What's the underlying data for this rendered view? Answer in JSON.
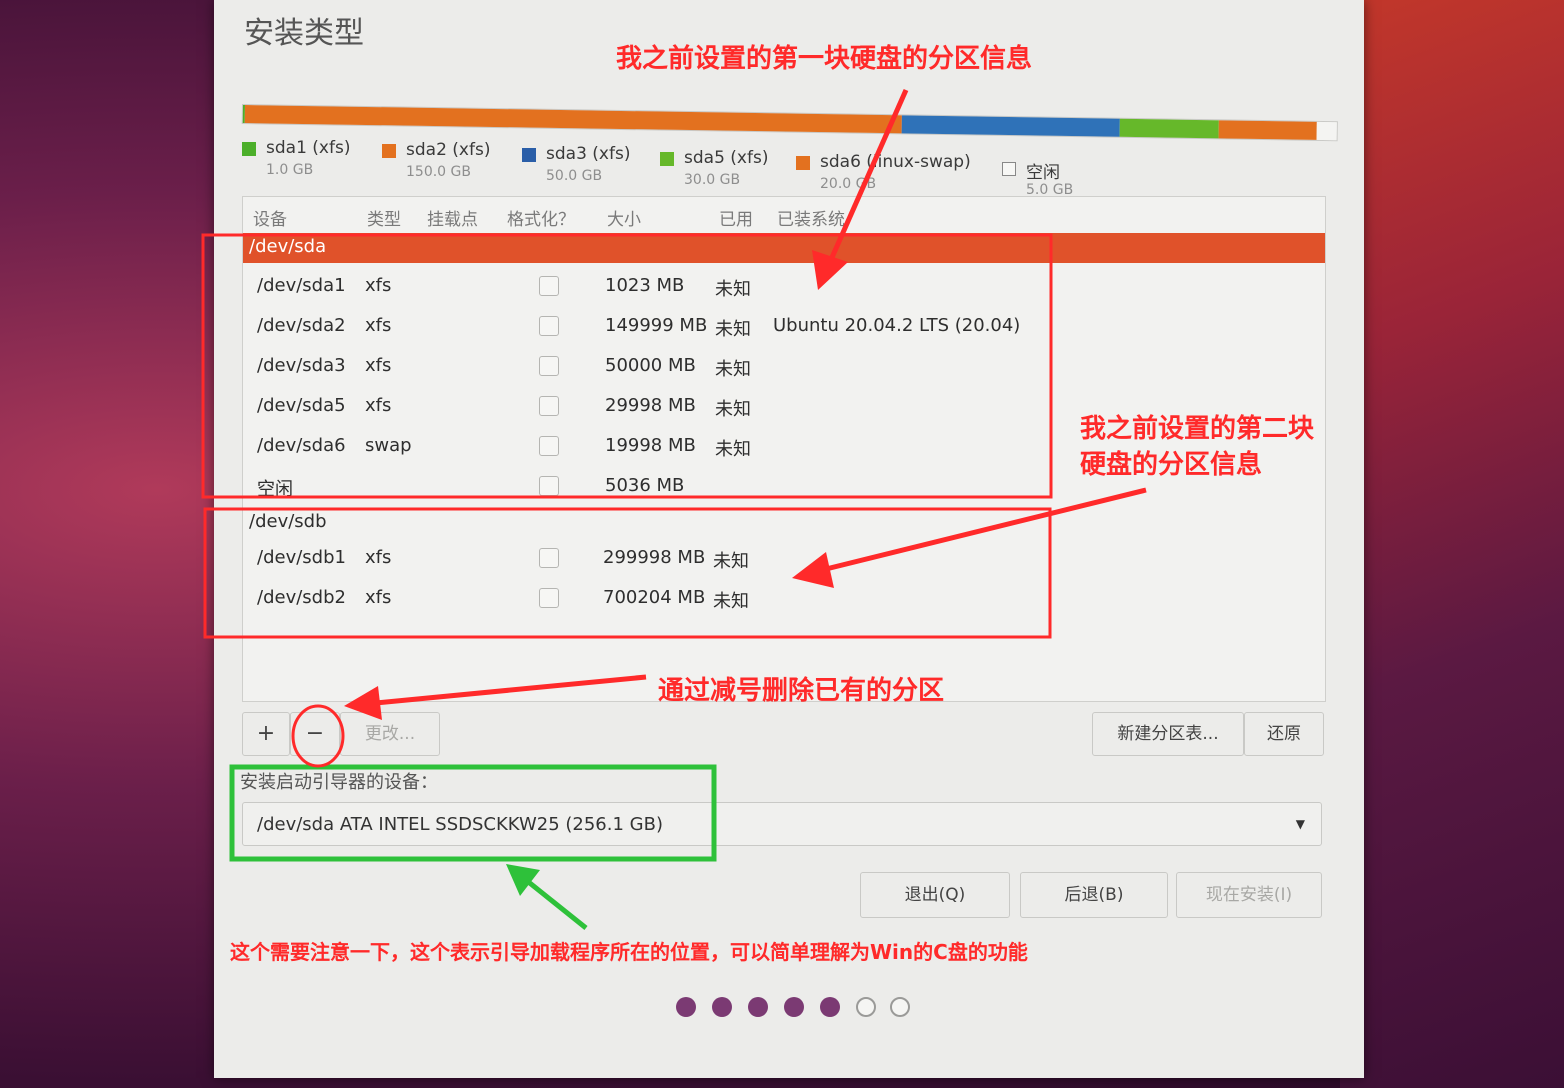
{
  "title": "安装类型",
  "disk_bar": [
    {
      "color": "#4caf2a",
      "fraction": 0.002
    },
    {
      "color": "#e3711f",
      "fraction": 0.6
    },
    {
      "color": "#2f72b8",
      "fraction": 0.2
    },
    {
      "color": "#66b82a",
      "fraction": 0.09
    },
    {
      "color": "#e3711f",
      "fraction": 0.09
    },
    {
      "color": "#f4f4f2",
      "fraction": 0.018
    }
  ],
  "legend": [
    {
      "name": "sda1 (xfs)",
      "size": "1.0 GB",
      "color": "#4caf2a"
    },
    {
      "name": "sda2 (xfs)",
      "size": "150.0 GB",
      "color": "#e3711f"
    },
    {
      "name": "sda3 (xfs)",
      "size": "50.0 GB",
      "color": "#2a5ea8"
    },
    {
      "name": "sda5 (xfs)",
      "size": "30.0 GB",
      "color": "#66b82a"
    },
    {
      "name": "sda6 (linux-swap)",
      "size": "20.0 GB",
      "color": "#e3711f"
    },
    {
      "name": "空闲",
      "size": "5.0 GB",
      "color": "#f7f7f5"
    }
  ],
  "columns": {
    "device": "设备",
    "type": "类型",
    "mount": "挂载点",
    "format": "格式化？",
    "size": "大小",
    "used": "已用",
    "system": "已装系统"
  },
  "rows": [
    {
      "device": "/dev/sda"
    },
    {
      "device": "/dev/sda1",
      "type": "xfs",
      "size": "1023 MB",
      "used": "未知",
      "system": ""
    },
    {
      "device": "/dev/sda2",
      "type": "xfs",
      "size": "149999 MB",
      "used": "未知",
      "system": "Ubuntu 20.04.2 LTS (20.04)"
    },
    {
      "device": "/dev/sda3",
      "type": "xfs",
      "size": "50000 MB",
      "used": "未知",
      "system": ""
    },
    {
      "device": "/dev/sda5",
      "type": "xfs",
      "size": "29998 MB",
      "used": "未知",
      "system": ""
    },
    {
      "device": "/dev/sda6",
      "type": "swap",
      "size": "19998 MB",
      "used": "未知",
      "system": ""
    },
    {
      "device": "空闲",
      "type": "",
      "size": "5036 MB",
      "used": "",
      "system": ""
    },
    {
      "device": "/dev/sdb"
    },
    {
      "device": "/dev/sdb1",
      "type": "xfs",
      "size": "299998 MB",
      "used": "未知",
      "system": ""
    },
    {
      "device": "/dev/sdb2",
      "type": "xfs",
      "size": "700204 MB",
      "used": "未知",
      "system": ""
    }
  ],
  "buttons": {
    "add": "+",
    "remove": "−",
    "change": "更改...",
    "new_table": "新建分区表...",
    "revert": "还原",
    "quit": "退出(Q)",
    "back": "后退(B)",
    "install": "现在安装(I)"
  },
  "bootloader": {
    "label": "安装启动引导器的设备：",
    "value": "/dev/sda  ATA INTEL SSDSCKKW25 (256.1 GB)"
  },
  "progress_dots": {
    "total": 7,
    "filled": 5
  },
  "annotations": {
    "disk1": "我之前设置的第一块硬盘的分区信息",
    "disk2_line1": "我之前设置的第二块",
    "disk2_line2": "硬盘的分区信息",
    "minus": "通过减号删除已有的分区",
    "boot": "这个需要注意一下，这个表示引导加载程序所在的位置，可以简单理解为Win的C盘的功能"
  },
  "colors": {
    "annotation": "#ff2a2a",
    "boot_box": "#2ec13a",
    "selected_row": "#e0522a",
    "dot_on": "#7b3a73"
  }
}
